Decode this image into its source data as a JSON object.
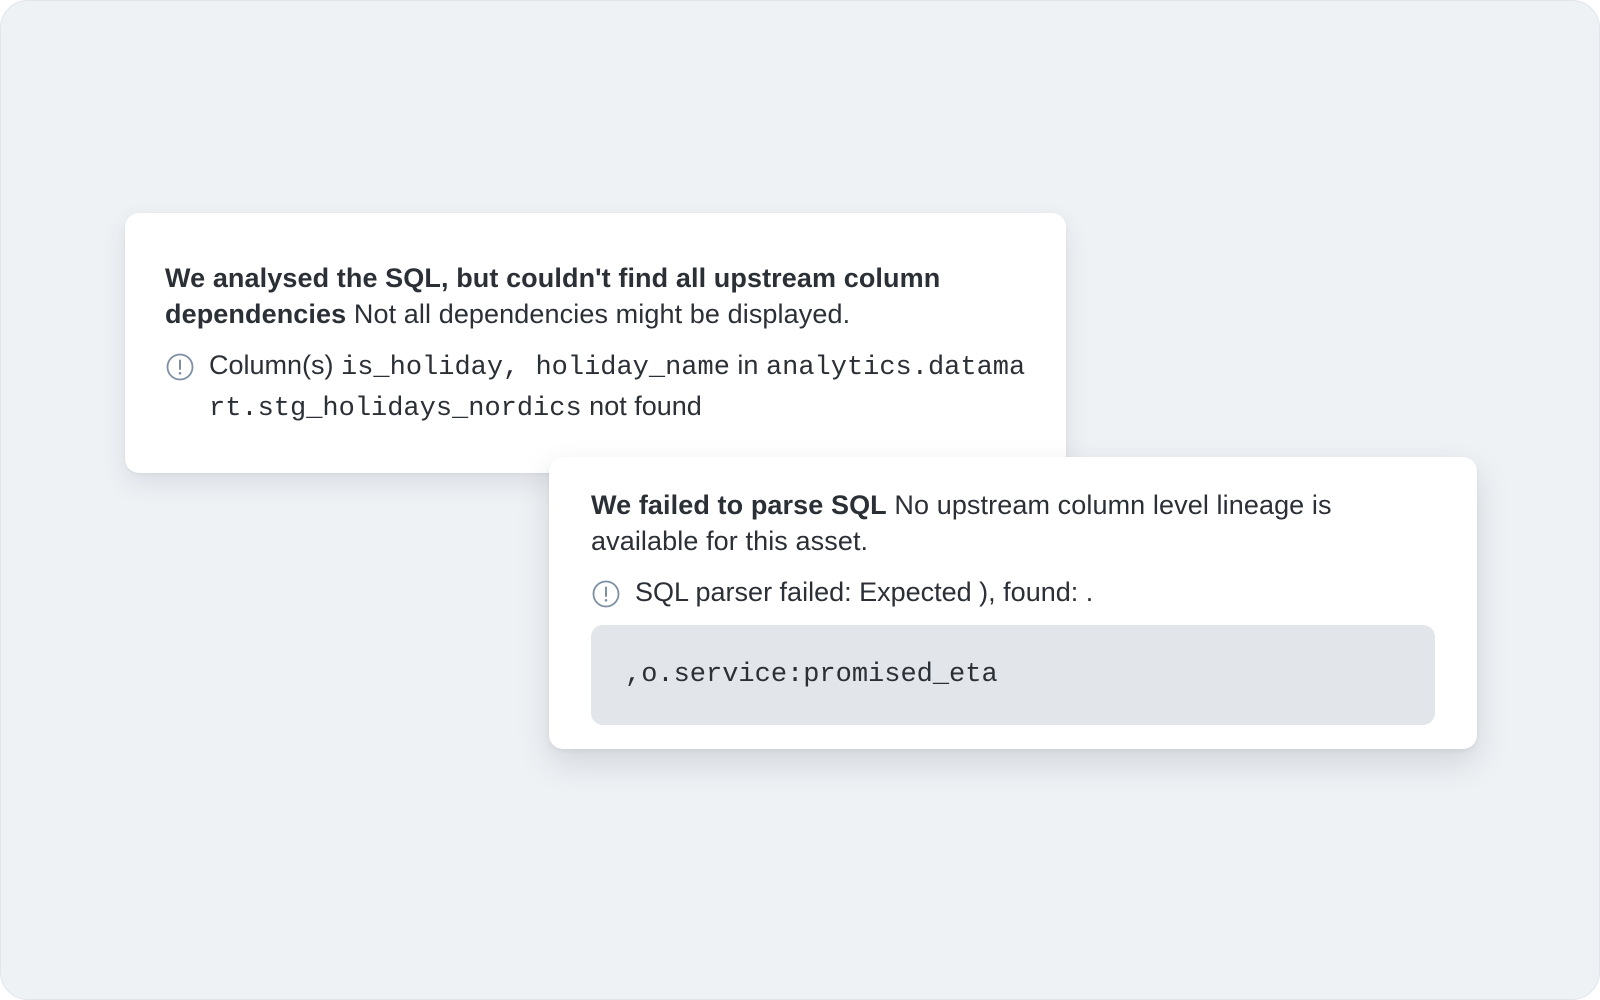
{
  "warning_card": {
    "headline_strong": "We analysed the SQL, but couldn't find all upstream column dependencies",
    "headline_rest": " Not all dependencies might be displayed.",
    "detail": {
      "icon": "info-circle-icon",
      "prefix": "Column(s) ",
      "columns": "is_holiday, holiday_name",
      "middle": " in ",
      "table": "analytics.datamart.stg_holidays_nordics",
      "suffix": " not found"
    }
  },
  "error_card": {
    "headline_strong": "We failed to parse SQL",
    "headline_rest": " No upstream column level lineage is available for this asset.",
    "detail": {
      "icon": "info-circle-icon",
      "text": "SQL parser failed: Expected ), found: ."
    },
    "code": ",o.service:promised_eta"
  },
  "colors": {
    "background": "#eff2f5",
    "card": "#ffffff",
    "text": "#2b2f36",
    "icon": "#7d8fa3",
    "code_background": "#e2e6ea"
  }
}
